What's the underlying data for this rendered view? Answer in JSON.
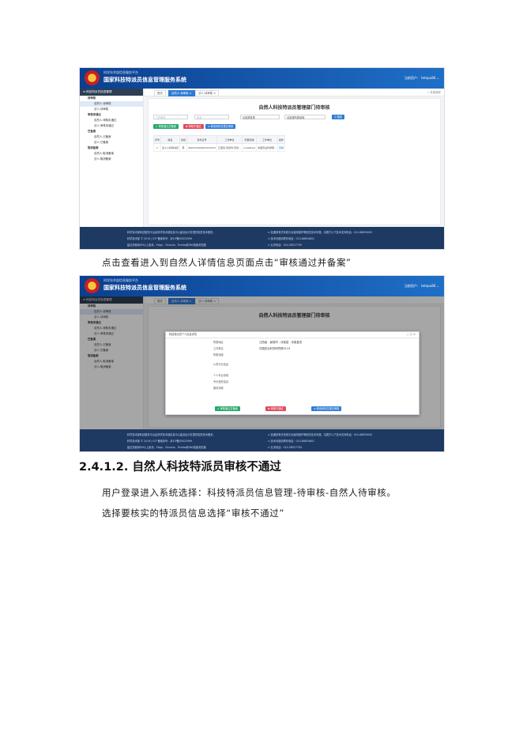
{
  "screenshot1": {
    "system_subtitle": "科学技术部信息服务平台",
    "system_title": "国家科技特派员信息管理服务系统",
    "user": "当前用户： tetepu86 ⌄",
    "side_header": "≡ 科技特派员信息管理",
    "side_items": [
      {
        "label": "待审核",
        "level": "g"
      },
      {
        "label": "自然人-待审核",
        "level": "c",
        "selected": true
      },
      {
        "label": "法人-待审核",
        "level": "c"
      },
      {
        "label": "审核未通过",
        "level": "g"
      },
      {
        "label": "自然人-审核未通过",
        "level": "c"
      },
      {
        "label": "法人-审核未通过",
        "level": "c"
      },
      {
        "label": "已备案",
        "level": "g"
      },
      {
        "label": "自然人-已备案",
        "level": "c"
      },
      {
        "label": "法人-已备案",
        "level": "c"
      },
      {
        "label": "取消备案",
        "level": "g"
      },
      {
        "label": "自然人-取消备案",
        "level": "c"
      },
      {
        "label": "法人-取消备案",
        "level": "c"
      }
    ],
    "tabs": [
      "首页",
      "自然人-待审核 ×",
      "法人-待审核 ×"
    ],
    "tabs_right": "» 关闭操作",
    "card_title": "自然人科技特派员管理部门待审核",
    "filters": [
      "工作单位",
      "姓名",
      "请选择性别",
      "请选择所属领域"
    ],
    "search_label": "Q 搜索",
    "buttons": [
      "✔ 审核通过并备案",
      "✖ 审核不通过",
      "⇆ 修改资料并提交审核"
    ],
    "columns": [
      "序号",
      "姓名",
      "性别",
      "身份证号",
      "工作单位",
      "所属领域",
      "工作单位",
      "操作"
    ],
    "row": [
      "1",
      "法人人科特派员",
      "男",
      "3601221996XXXX1613",
      "江西省-景德市-景德...",
      "undefined",
      "中国农业科学研...",
      "查看"
    ]
  },
  "caption1": "点击查看进入到自然人详情信息页面点击“审核通过并备案”",
  "screenshot2": {
    "user": "当前用户： tetepu86 ⌄",
    "modal_title": "科技特派员个人信息详情",
    "modal_labels": [
      "所属地区",
      "工作单位",
      "所属领域",
      "从事行业信息",
      "个人专业领域",
      "专长相关信息",
      "服务领域"
    ],
    "modal_values": [
      "江西省 - 景德市 - 浮梁县 - 浮梁县农",
      "中国农业科学研究院5113"
    ],
    "modal_buttons": [
      "✔ 审核通过并备案",
      "✖ 审核不通过",
      "⇆ 修改资料并提交审核"
    ]
  },
  "footer": {
    "left": [
      "科学技术部科技服务平台由科学技术部信息中心建设运行并提供相关技术服务。",
      "科学技术部 © 2019 | ICP 备案序号：京ICP备05022999",
      "建议您使用IE9以上版本，Edge、Chrome、Firefox和360极速浏览器",
      "浏览器以获得最佳效果。"
    ],
    "right": [
      "⊙ 如遇到有关系统平台使用操作等相关技术问题，请拨打以下技术支持电话：010-88659000",
      "⊙ 技术问题请联系电话：010-88654801",
      "⊙ 业务电话：010-58527700"
    ]
  },
  "heading": "2.4.1.2. 自然人科技特派员审核不通过",
  "para1": "用户登录进入系统选择：科技特派员信息管理-待审核-自然人待审核。",
  "para2": "选择要核实的特派员信息选择“审核不通过”"
}
